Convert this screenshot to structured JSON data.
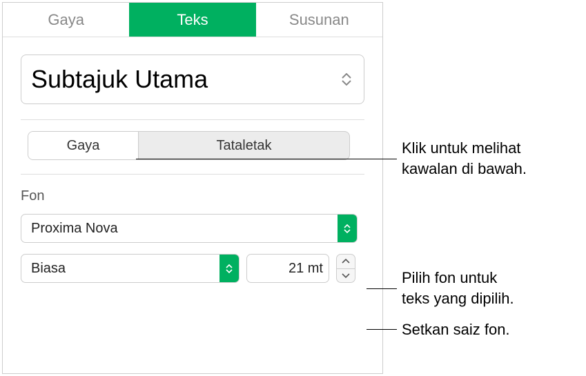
{
  "top_tabs": {
    "gaya": "Gaya",
    "teks": "Teks",
    "susunan": "Susunan"
  },
  "paragraph_style": {
    "selected": "Subtajuk Utama"
  },
  "seg": {
    "gaya": "Gaya",
    "tataletak": "Tataletak"
  },
  "font": {
    "section_label": "Fon",
    "family": "Proxima Nova",
    "weight": "Biasa",
    "size": "21 mt"
  },
  "callouts": {
    "c1": "Klik untuk melihat\nkawalan di bawah.",
    "c2": "Pilih fon untuk\nteks yang dipilih.",
    "c3": "Setkan saiz fon."
  }
}
